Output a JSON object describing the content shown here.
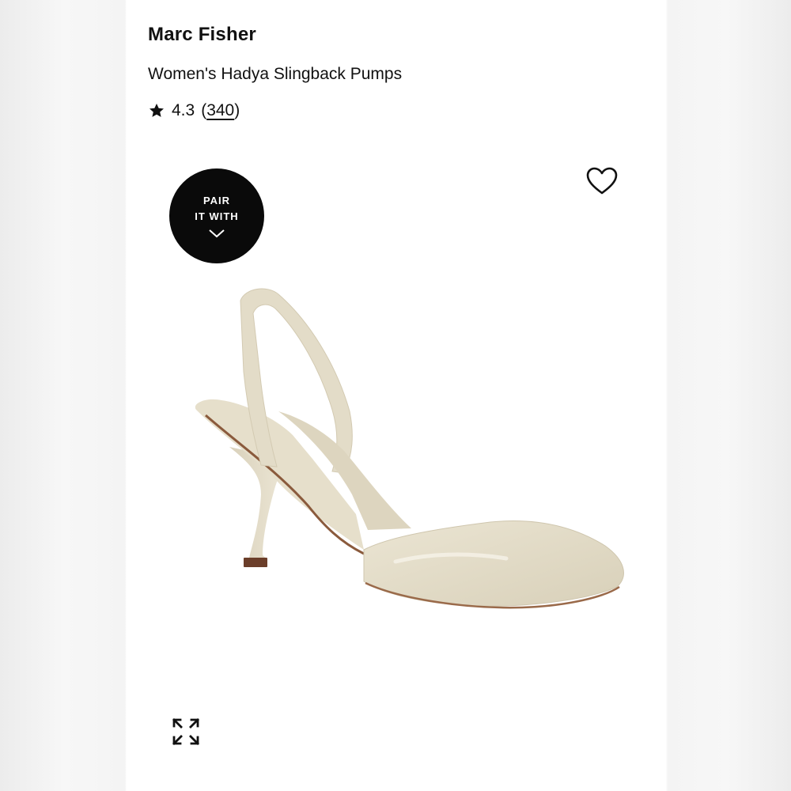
{
  "product": {
    "brand": "Marc Fisher",
    "name": "Women's Hadya Slingback Pumps",
    "rating": {
      "score": "4.3",
      "open_paren": "(",
      "count": "340",
      "close_paren": ")"
    }
  },
  "pair_badge": {
    "line1": "PAIR",
    "line2": "IT WITH",
    "icon": "chevron-down-icon"
  },
  "icons": {
    "rating": "star-icon",
    "wishlist": "heart-icon",
    "fullscreen": "expand-icon"
  },
  "colors": {
    "text": "#111111",
    "badge_bg": "#0a0a0a",
    "shoe_main": "#e3dcc8",
    "shoe_heel_tip": "#6b3e2a"
  }
}
